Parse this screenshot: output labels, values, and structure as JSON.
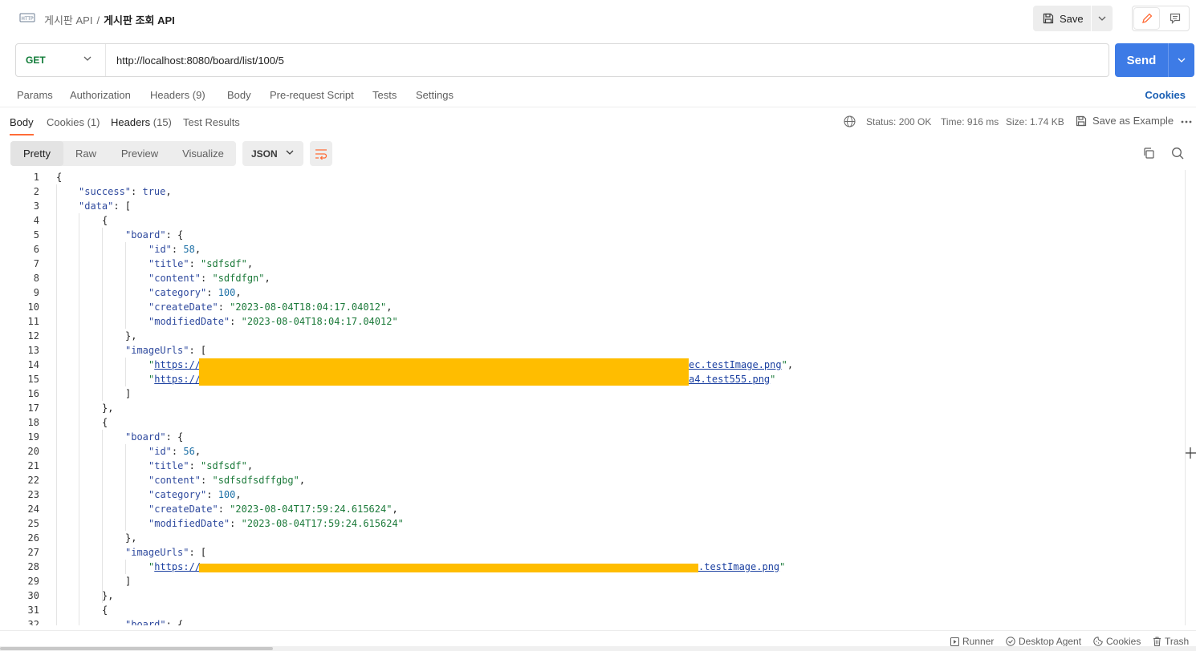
{
  "header": {
    "breadcrumb_parent": "게시판 API",
    "breadcrumb_sep": "/",
    "breadcrumb_current": "게시판 조회 API",
    "save_label": "Save"
  },
  "request": {
    "method": "GET",
    "url": "http://localhost:8080/board/list/100/5",
    "send_label": "Send"
  },
  "request_tabs": {
    "params": "Params",
    "authorization": "Authorization",
    "headers": "Headers",
    "headers_count": "(9)",
    "body": "Body",
    "prerequest": "Pre-request Script",
    "tests": "Tests",
    "settings": "Settings",
    "cookies": "Cookies"
  },
  "response_tabs": {
    "body": "Body",
    "cookies": "Cookies",
    "cookies_count": "(1)",
    "headers": "Headers",
    "headers_count": "(15)",
    "test_results": "Test Results"
  },
  "response_meta": {
    "status": "Status: 200 OK",
    "time": "Time: 916 ms",
    "size": "Size: 1.74 KB",
    "save_example": "Save as Example"
  },
  "view_modes": {
    "pretty": "Pretty",
    "raw": "Raw",
    "preview": "Preview",
    "visualize": "Visualize",
    "format": "JSON"
  },
  "code_lines": {
    "l1": "{",
    "l2_key": "\"success\"",
    "l2_val": "true",
    "l3_key": "\"data\"",
    "l3_tail": ": [",
    "l4": "{",
    "l5_key": "\"board\"",
    "l5_tail": ": {",
    "l6_key": "\"id\"",
    "l6_val": "58",
    "l7_key": "\"title\"",
    "l7_val": "\"sdfsdf\"",
    "l8_key": "\"content\"",
    "l8_val": "\"sdfdfgn\"",
    "l9_key": "\"category\"",
    "l9_val": "100",
    "l10_key": "\"createDate\"",
    "l10_val": "\"2023-08-04T18:04:17.04012\"",
    "l11_key": "\"modifiedDate\"",
    "l11_val": "\"2023-08-04T18:04:17.04012\"",
    "l12": "},",
    "l13_key": "\"imageUrls\"",
    "l13_tail": ": [",
    "l14_pre": "https://",
    "l14_post": "ec.testImage.png",
    "l15_pre": "https://",
    "l15_post": "a4.test555.png",
    "l16": "]",
    "l17": "},",
    "l18": "{",
    "l19_key": "\"board\"",
    "l19_tail": ": {",
    "l20_key": "\"id\"",
    "l20_val": "56",
    "l21_key": "\"title\"",
    "l21_val": "\"sdfsdf\"",
    "l22_key": "\"content\"",
    "l22_val": "\"sdfsdfsdffgbg\"",
    "l23_key": "\"category\"",
    "l23_val": "100",
    "l24_key": "\"createDate\"",
    "l24_val": "\"2023-08-04T17:59:24.615624\"",
    "l25_key": "\"modifiedDate\"",
    "l25_val": "\"2023-08-04T17:59:24.615624\"",
    "l26": "},",
    "l27_key": "\"imageUrls\"",
    "l27_tail": ": [",
    "l28_pre": "https://",
    "l28_post": ".testImage.png",
    "l29": "]",
    "l30": "},",
    "l31": "{",
    "l32_key": "\"board\"",
    "l32_tail": ": {"
  },
  "statusbar": {
    "runner": "Runner",
    "desktop_agent": "Desktop Agent",
    "cookies": "Cookies",
    "trash": "Trash"
  },
  "colors": {
    "accent_orange": "#ff6c37",
    "send_blue": "#3d7be6",
    "redaction": "#ffbd00",
    "method_green": "#0f7b37"
  }
}
